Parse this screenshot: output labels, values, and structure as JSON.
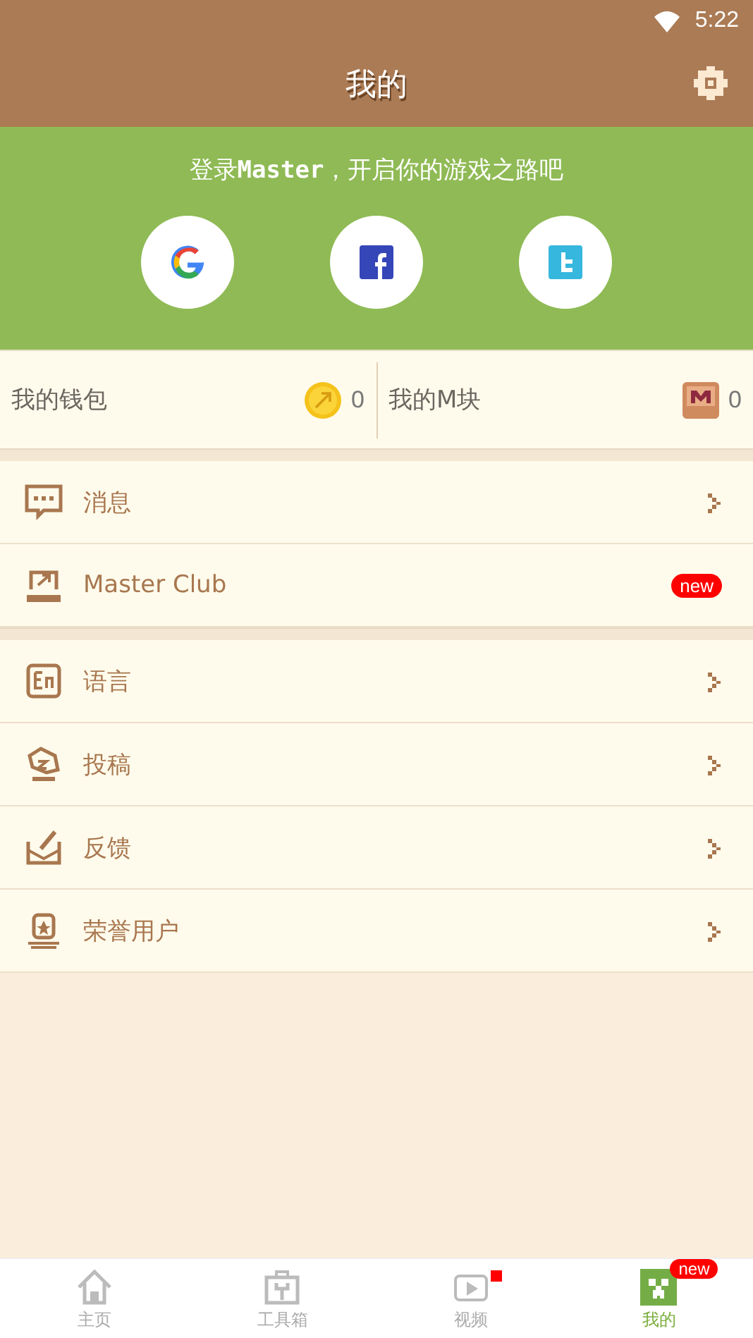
{
  "status_bar": {
    "time": "5:22"
  },
  "header": {
    "title": "我的"
  },
  "login": {
    "prompt": "登录**Master**，开启你的游戏之路吧",
    "providers": [
      {
        "kind": "google"
      },
      {
        "kind": "facebook"
      },
      {
        "kind": "twitter"
      }
    ]
  },
  "wallet": [
    {
      "kind": "coin",
      "label": "我的钱包",
      "value": "0"
    },
    {
      "kind": "block",
      "label": "我的M块",
      "value": "0"
    }
  ],
  "menu_groups": [
    [
      {
        "label": "消息",
        "kind": "arrow"
      },
      {
        "label": "Master Club",
        "kind": "badge",
        "badge": "new"
      }
    ],
    [
      {
        "label": "语言",
        "kind": "arrow"
      },
      {
        "label": "投稿",
        "kind": "arrow"
      },
      {
        "label": "反馈",
        "kind": "arrow"
      },
      {
        "label": "荣誉用户",
        "kind": "arrow"
      }
    ]
  ],
  "tabs": [
    {
      "label": "主页",
      "selected": false,
      "dot": false
    },
    {
      "label": "工具箱",
      "selected": false,
      "dot": false
    },
    {
      "label": "视频",
      "selected": false,
      "dot": true
    },
    {
      "label": "我的",
      "selected": true,
      "dot": false,
      "badge": "new"
    }
  ]
}
